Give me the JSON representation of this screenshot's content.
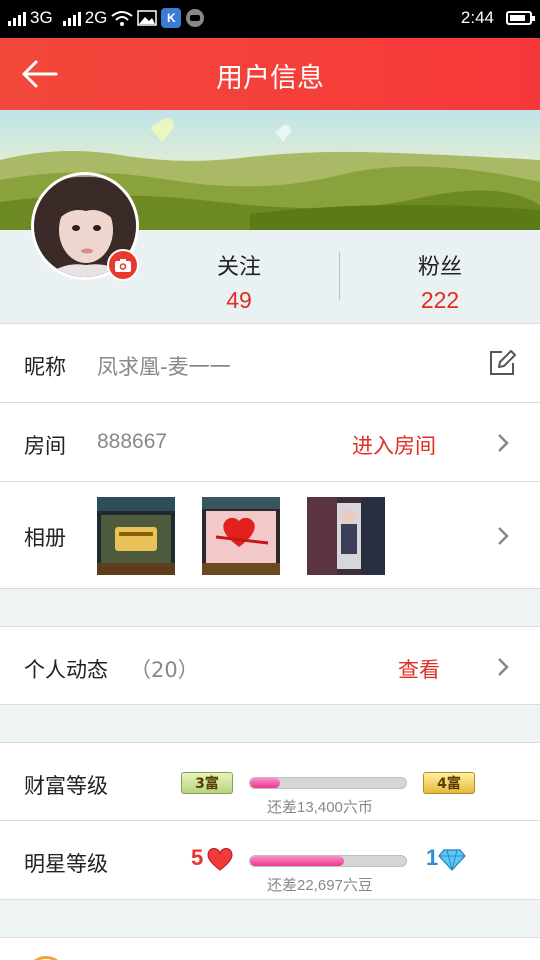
{
  "status_bar": {
    "network_1": "3G",
    "network_2": "2G",
    "time": "2:44",
    "battery_level": 0.85
  },
  "header": {
    "title": "用户信息",
    "back_icon": "arrow-left-icon"
  },
  "profile": {
    "follow_label": "关注",
    "follow_count": "49",
    "fans_label": "粉丝",
    "fans_count": "222",
    "camera_icon": "camera-icon"
  },
  "nickname": {
    "label": "昵称",
    "value": "凤求凰-麦一一",
    "edit_icon": "edit-icon"
  },
  "room": {
    "label": "房间",
    "value": "888667",
    "action": "进入房间"
  },
  "album": {
    "label": "相册",
    "thumbs": [
      "photo-thumb-1",
      "photo-thumb-2",
      "photo-thumb-3"
    ]
  },
  "activity": {
    "label": "个人动态",
    "count": "（20）",
    "action": "查看"
  },
  "wealth": {
    "label": "财富等级",
    "current_badge": "3富",
    "next_badge": "4富",
    "progress": 0.19,
    "hint": "还差13,400六币"
  },
  "star": {
    "label": "明星等级",
    "current_level": "5",
    "next_level": "1",
    "progress": 0.6,
    "hint": "还差22,697六豆"
  },
  "colors": {
    "accent": "#e22d24",
    "header": "#f2483b",
    "progress": "#e8388f"
  }
}
